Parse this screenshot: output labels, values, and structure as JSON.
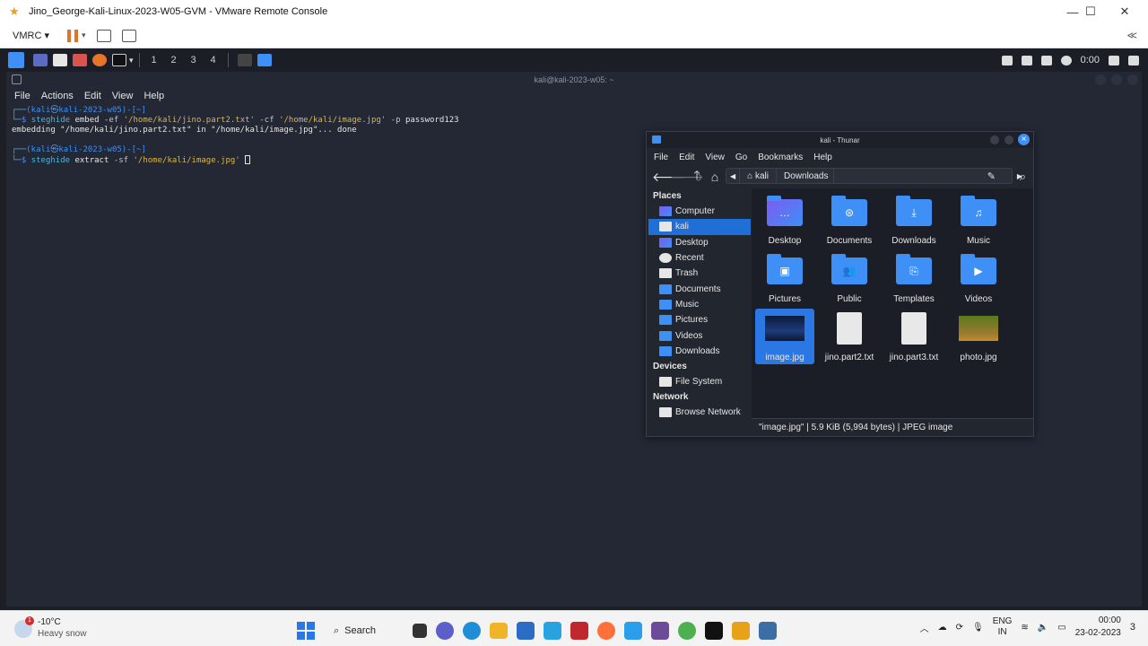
{
  "window": {
    "title": "Jino_George-Kali-Linux-2023-W05-GVM - VMware Remote Console",
    "minimize": "—",
    "maximize": "☐",
    "close": "✕"
  },
  "vmrc": {
    "menu_label": "VMRC ▾",
    "collapse": "≪"
  },
  "kali_panel": {
    "workspaces": [
      "1",
      "2",
      "3",
      "4"
    ],
    "clock": "0:00"
  },
  "terminal": {
    "title": "kali@kali-2023-w05: ~",
    "menu": [
      "File",
      "Actions",
      "Edit",
      "View",
      "Help"
    ],
    "line1_user": "(kali㉿kali-2023-w05)-[~]",
    "line2_cmd": "steghide",
    "line2_args1": " embed ",
    "line2_ef": "-ef",
    "line2_file1": " '/home/kali/jino.part2.txt'",
    "line2_cf": " -cf",
    "line2_file2": " '/home/kali/image.jpg'",
    "line2_p": " -p",
    "line2_pw": " password123",
    "line3_output": "embedding \"/home/kali/jino.part2.txt\" in \"/home/kali/image.jpg\"... done",
    "line4_user": "(kali㉿kali-2023-w05)-[~]",
    "line5_cmd": "steghide",
    "line5_args1": " extract ",
    "line5_sf": "-sf",
    "line5_file": " '/home/kali/image.jpg'"
  },
  "thunar": {
    "title": "kali - Thunar",
    "menu": [
      "File",
      "Edit",
      "View",
      "Go",
      "Bookmarks",
      "Help"
    ],
    "path": [
      "kali",
      "Downloads"
    ],
    "places_header": "Places",
    "places": [
      "Computer",
      "kali",
      "Desktop",
      "Recent",
      "Trash",
      "Documents",
      "Music",
      "Pictures",
      "Videos",
      "Downloads"
    ],
    "devices_header": "Devices",
    "devices": [
      "File System"
    ],
    "network_header": "Network",
    "network": [
      "Browse Network"
    ],
    "files": [
      "Desktop",
      "Documents",
      "Downloads",
      "Music",
      "Pictures",
      "Public",
      "Templates",
      "Videos",
      "image.jpg",
      "jino.part2.txt",
      "jino.part3.txt",
      "photo.jpg"
    ],
    "status": "\"image.jpg\"  |  5.9 KiB (5,994 bytes)  |  JPEG image"
  },
  "taskbar": {
    "weather_temp": "-10°C",
    "weather_desc": "Heavy snow",
    "weather_badge": "1",
    "search_label": "Search",
    "lang_top": "ENG",
    "lang_bottom": "IN",
    "time": "00:00",
    "date": "23-02-2023",
    "notification_count": "3"
  },
  "colors": {
    "accent": "#3e8ff6",
    "terminal_bg": "#232834",
    "selection": "#1f6fd6"
  }
}
